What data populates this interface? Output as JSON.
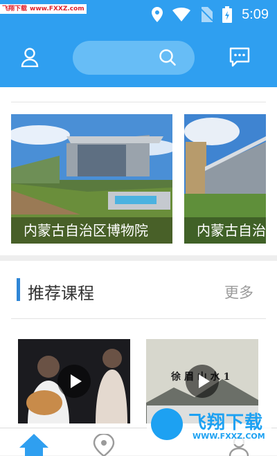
{
  "watermark_top": {
    "a": "飞翔下载",
    "b": "www.FXXZ.com"
  },
  "status": {
    "time": "5:09"
  },
  "header": {
    "icons": {
      "user": "user-icon",
      "search": "search-icon",
      "chat": "chat-icon"
    }
  },
  "museums": [
    {
      "caption": "内蒙古自治区博物院"
    },
    {
      "caption": "内蒙古自治区博物院"
    }
  ],
  "section": {
    "title": "推荐课程",
    "more": "更多"
  },
  "courses": [
    {
      "thumb_text": ""
    },
    {
      "thumb_text": "徐 眉 山 水 1"
    }
  ],
  "watermark_bottom": {
    "brand": "飞翔下载",
    "url": "WWW.FXXZ.COM"
  },
  "colors": {
    "primary": "#2f9ff0",
    "search_bg": "#67bdf6",
    "accent": "#2f86d6"
  }
}
